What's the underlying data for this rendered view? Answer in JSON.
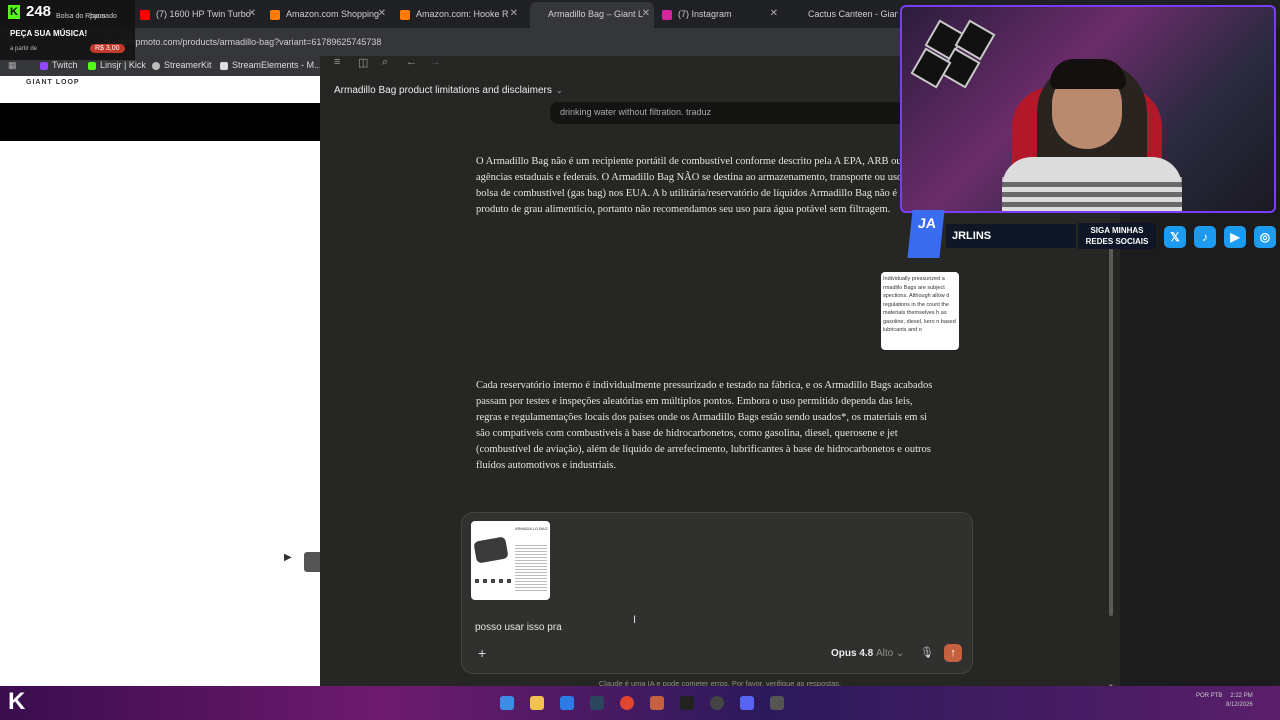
{
  "browser": {
    "tabs": [
      {
        "label": "Bolsa do Rhyno Market",
        "color": "#53fc18"
      },
      {
        "label": "(7) 1600 HP Twin Turbo",
        "color": "#ff0000"
      },
      {
        "label": "Amazon.com Shopping",
        "color": "#ff7a00"
      },
      {
        "label": "Amazon.com: Hooke R",
        "color": "#ff7a00"
      },
      {
        "label": "Armadillo Bag – Giant L",
        "color": "#ffffff"
      },
      {
        "label": "(7) Instagram",
        "color": "#d6249f"
      },
      {
        "label": "Cactus Canteen - Gian",
        "color": "#ffffff"
      }
    ],
    "url": "giantloopmoto.com/products/armadillo-bag?variant=61789625745738",
    "bookmarks": [
      "Twitch",
      "Linsjr | Kick",
      "StreamerKit",
      "StreamElements - M..."
    ]
  },
  "kick_overlay": {
    "count": "248",
    "user": "Bolsa do Rhyno",
    "status": "pausado",
    "title": "PEÇA SUA MÚSICA!",
    "from": "a partir de",
    "price": "R$ 3,00"
  },
  "website": {
    "logo": "GIANT LOOP"
  },
  "app": {
    "conversation_title": "Armadillo Bag product limitations and disclaimers",
    "previous_user_message": "drinking water without filtration.  traduz",
    "response_paragraph_1": "O Armadillo Bag não é um recipiente portátil de combustível conforme descrito pela A EPA, ARB ou outras agências estaduais e federais. O Armadillo Bag NÃO se destina ao armazenamento, transporte ou uso como bolsa de combustível (gas bag) nos EUA. A b utilitária/reservatório de líquidos Armadillo Bag não é um produto de grau alimentício, portanto não recomendamos seu uso para água potável sem filtragem.",
    "image_snippet": "Individually pressurized a rmadillo Bags are subject spections. Although allow d regulations in the count the materials themselves h as gasoline, diesel, kero n based lubricants and o",
    "response_paragraph_2": "Cada reservatório interno é individualmente pressurizado e testado na fábrica, e os Armadillo Bags acabados passam por testes e inspeções aleatórias em múltiplos pontos. Embora o uso permitido dependa das leis, regras e regulamentações locais dos países onde os Armadillo Bags estão sendo usados*, os materiais em si são compatíveis com combustíveis à base de hidrocarbonetos, como gasolina, diesel, querosene e jet (combustível de aviação), além de líquido de arrefecimento, lubrificantes à base de hidrocarbonetos e outros fluidos automotivos e industriais.",
    "composer": {
      "text": "posso usar isso pra",
      "model": "Opus 4.8",
      "effort": "Alto"
    },
    "disclaimer": "Claude é uma IA e pode cometer erros. Por favor, verifique as respostas."
  },
  "stream_overlay": {
    "logo": "JA",
    "name": "JRLINS",
    "follow": "SIGA MINHAS REDES SOCIAIS",
    "socials": [
      {
        "icon": "x-icon",
        "glyph": "𝕏",
        "color": "#1d9bf0"
      },
      {
        "icon": "tiktok-icon",
        "glyph": "♪",
        "color": "#1d9bf0"
      },
      {
        "icon": "youtube-icon",
        "glyph": "▶",
        "color": "#1d9bf0"
      },
      {
        "icon": "instagram-icon",
        "glyph": "◎",
        "color": "#1d9bf0"
      }
    ]
  },
  "taskbar": {
    "time": "2:22 PM",
    "date": "8/12/2026",
    "lang": "POR PTB"
  },
  "colors": {
    "accent_send": "#c6613f",
    "kick_green": "#53fc18",
    "app_bg": "#262624"
  }
}
